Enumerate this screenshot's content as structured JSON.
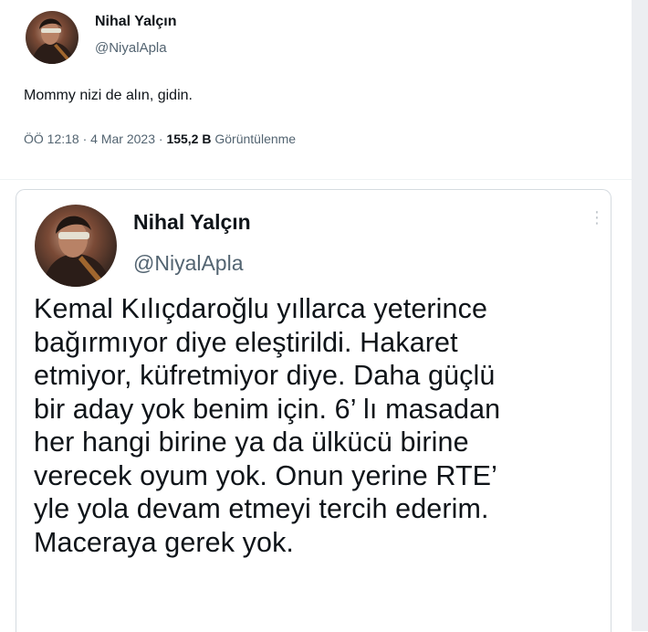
{
  "outer_tweet": {
    "author_name": "Nihal Yalçın",
    "author_handle": "@NiyalApla",
    "text": "Mommy nizi de alın, gidin.",
    "time": "ÖÖ 12:18",
    "date": "4 Mar 2023",
    "views_count": "155,2 B",
    "views_label": "Görüntülenme",
    "separator": "·"
  },
  "quoted_tweet": {
    "author_name": "Nihal Yalçın",
    "author_handle": "@NiyalApla",
    "menu_glyph": "⋮",
    "text_lines": [
      "Kemal Kılıçdaroğlu yıllarca yeterince",
      "bağırmıyor diye eleştirildi. Hakaret",
      "etmiyor, küfretmiyor diye. Daha güçlü",
      "bir aday yok benim için. 6’ lı masadan",
      "her hangi birine ya da ülkücü birine",
      "verecek oyum yok. Onun yerine RTE’",
      "yle yola devam etmeyi tercih ederim.",
      "Maceraya gerek yok."
    ]
  },
  "colors": {
    "text_primary": "#0f1419",
    "text_secondary": "#536471",
    "border": "#d5dbe0",
    "side_strip": "#eceef1"
  },
  "icons": {
    "avatar": "profile-photo",
    "menu": "more-vertical-icon"
  }
}
